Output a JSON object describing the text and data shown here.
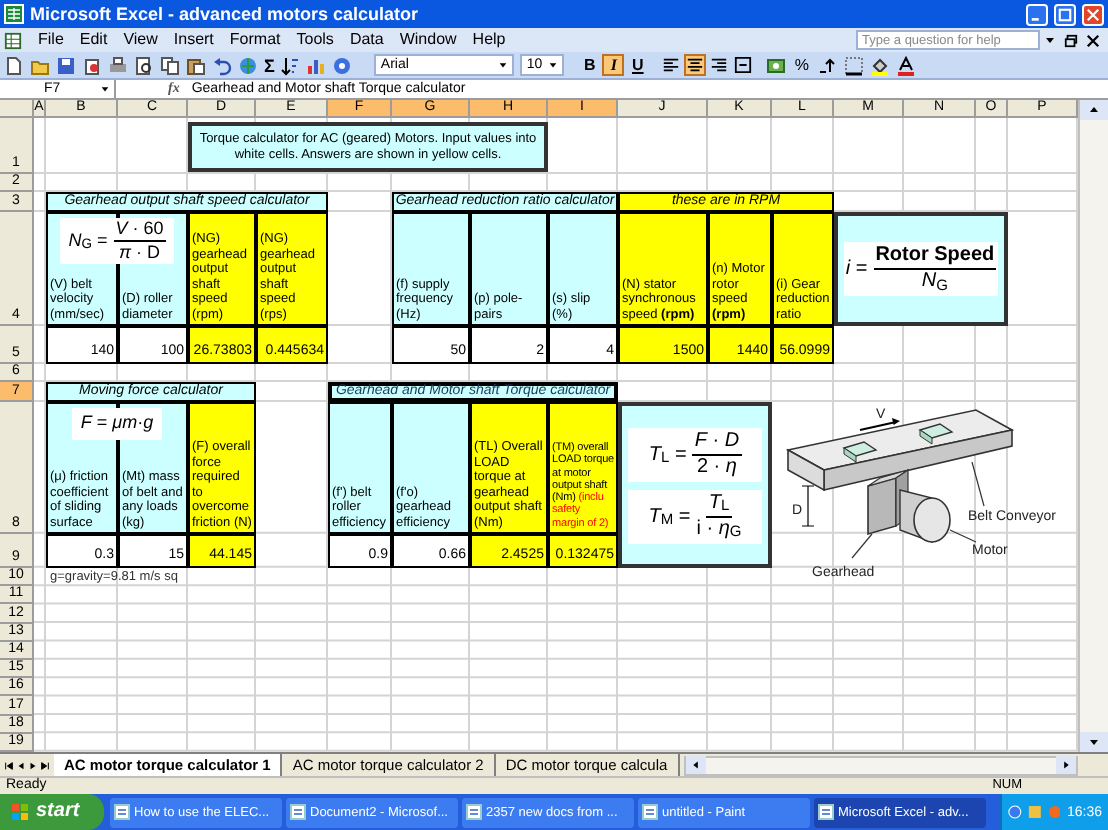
{
  "window": {
    "title": "Microsoft Excel - advanced motors calculator"
  },
  "menu": [
    "File",
    "Edit",
    "View",
    "Insert",
    "Format",
    "Tools",
    "Data",
    "Window",
    "Help"
  ],
  "help_box": {
    "placeholder": "Type a question for help"
  },
  "toolbar": {
    "sum": "Σ",
    "font": "Arial",
    "size": "10",
    "percent": "%",
    "format_buttons": [
      {
        "label": "B",
        "on": false
      },
      {
        "label": "I",
        "on": true
      },
      {
        "label": "U",
        "on": false
      }
    ],
    "align_buttons": [
      {
        "on": false
      },
      {
        "on": true
      },
      {
        "on": false
      },
      {
        "on": false
      }
    ]
  },
  "formula_bar": {
    "name_box": "F7",
    "fx": "fx",
    "content": "Gearhead and Motor shaft Torque calculator"
  },
  "columns": [
    {
      "label": "A",
      "selected": false
    },
    {
      "label": "B",
      "selected": false
    },
    {
      "label": "C",
      "selected": false
    },
    {
      "label": "D",
      "selected": false
    },
    {
      "label": "E",
      "selected": false
    },
    {
      "label": "F",
      "selected": true
    },
    {
      "label": "G",
      "selected": true
    },
    {
      "label": "H",
      "selected": true
    },
    {
      "label": "I",
      "selected": true
    },
    {
      "label": "J",
      "selected": false
    },
    {
      "label": "K",
      "selected": false
    },
    {
      "label": "L",
      "selected": false
    },
    {
      "label": "M",
      "selected": false
    },
    {
      "label": "N",
      "selected": false
    },
    {
      "label": "O",
      "selected": false
    },
    {
      "label": "P",
      "selected": false
    }
  ],
  "rows": [
    {
      "label": "1",
      "selected": false
    },
    {
      "label": "2",
      "selected": false
    },
    {
      "label": "3",
      "selected": false
    },
    {
      "label": "4",
      "selected": false
    },
    {
      "label": "5",
      "selected": false
    },
    {
      "label": "6",
      "selected": false
    },
    {
      "label": "7",
      "selected": true
    },
    {
      "label": "8",
      "selected": false
    },
    {
      "label": "9",
      "selected": false
    },
    {
      "label": "10",
      "selected": false
    },
    {
      "label": "11",
      "selected": false
    },
    {
      "label": "12",
      "selected": false
    },
    {
      "label": "13",
      "selected": false
    },
    {
      "label": "14",
      "selected": false
    },
    {
      "label": "15",
      "selected": false
    },
    {
      "label": "16",
      "selected": false
    },
    {
      "label": "17",
      "selected": false
    },
    {
      "label": "18",
      "selected": false
    },
    {
      "label": "19",
      "selected": false
    }
  ],
  "sheet": {
    "intro": "Torque calculator for AC (geared) Motors. Input values into white cells. Answers are shown in yellow cells.",
    "sections": [
      {
        "title": {
          "text": "Gearhead output shaft speed calculator",
          "kind": "input",
          "selected": false
        },
        "formula": {
          "kind": "fraction",
          "lhs": "*N*$_{G}$ =",
          "numerator": "*V* · 60",
          "denominator": "*π* · D"
        },
        "columns": [
          {
            "header": "(V) belt velocity (mm/sec)",
            "value": "140",
            "kind": "input"
          },
          {
            "header": "(D) roller diameter",
            "value": "100",
            "kind": "input"
          },
          {
            "header": "(NG) gearhead output shaft speed (rpm)",
            "value": "26.73803",
            "kind": "output"
          },
          {
            "header": "(NG) gearhead output shaft speed (rps)",
            "value": "0.445634",
            "kind": "output"
          }
        ]
      },
      {
        "title": {
          "text": "Gearhead reduction ratio calculator",
          "kind": "input",
          "selected": false
        },
        "columns": [
          {
            "header": "(f) supply frequency (Hz)",
            "value": "50",
            "kind": "input"
          },
          {
            "header": "(p) pole-pairs",
            "value": "2",
            "kind": "input"
          },
          {
            "header": "(s) slip (%)",
            "value": "4",
            "kind": "input"
          }
        ]
      },
      {
        "title": {
          "text": "these are in RPM",
          "kind": "output",
          "selected": false
        },
        "columns": [
          {
            "header": "(N) stator synchronous speed **(rpm)**",
            "value": "1500",
            "kind": "output"
          },
          {
            "header": "(n) Motor rotor speed **(rpm)**",
            "value": "1440",
            "kind": "output"
          },
          {
            "header": "(i) Gear reduction ratio",
            "value": "56.0999",
            "kind": "output"
          }
        ]
      },
      {
        "title": {
          "text": "Moving force calculator",
          "kind": "input",
          "selected": false
        },
        "formula": {
          "kind": "inline",
          "text": "*F* = *μm*·*g*"
        },
        "columns": [
          {
            "header": "(μ) friction coefficient of sliding surface",
            "value": "0.3",
            "kind": "input"
          },
          {
            "header": "(Mt) mass of belt and any loads (kg)",
            "value": "15",
            "kind": "input"
          },
          {
            "header": "(F) overall force required to overcome friction (N)",
            "value": "44.145",
            "kind": "output"
          }
        ]
      },
      {
        "title": {
          "text": "Gearhead and Motor shaft Torque calculator",
          "kind": "input",
          "selected": true
        },
        "columns": [
          {
            "header": "(f') belt roller efficiency",
            "value": "0.9",
            "kind": "input"
          },
          {
            "header": "(f'o) gearhead efficiency",
            "value": "0.66",
            "kind": "input"
          },
          {
            "header": "(TL) Overall LOAD torque at gearhead output shaft (Nm)",
            "value": "2.4525",
            "kind": "output"
          },
          {
            "header": "(TM) overall LOAD torque at motor output shaft (Nm)",
            "note": "(inclu safety margin of 2)",
            "value": "0.132475",
            "kind": "output"
          }
        ]
      }
    ],
    "formula_panels": [
      {
        "formulas": [
          {
            "kind": "fraction",
            "lhs": "*i* =",
            "numerator": "**Rotor Speed**",
            "denominator": "*N*$_{G}$"
          }
        ]
      },
      {
        "formulas": [
          {
            "kind": "fraction",
            "lhs": "*T*$_{L}$ =",
            "numerator": "*F* · *D*",
            "denominator": "2 · *η*"
          },
          {
            "kind": "fraction",
            "lhs": "*T*$_{M}$ =",
            "numerator": "*T*$_{L}$",
            "denominator": "i · *η*$_{G}$"
          }
        ]
      }
    ],
    "note": "g=gravity=9.81 m/s sq",
    "drawing": {
      "labels": [
        "V",
        "D",
        "Belt Conveyor",
        "Motor",
        "Gearhead"
      ]
    }
  },
  "sheet_tabs": [
    {
      "label": "AC motor torque calculator 1",
      "selected": true
    },
    {
      "label": "AC motor torque calculator 2",
      "selected": false
    },
    {
      "label": "DC motor torque calcula",
      "selected": false
    }
  ],
  "status_bar": {
    "text": "Ready",
    "num": "NUM"
  },
  "taskbar": {
    "start": "start",
    "tasks": [
      {
        "label": "How to use the ELEC...",
        "selected": false
      },
      {
        "label": "Document2 - Microsof...",
        "selected": false
      },
      {
        "label": "2357 new docs from ...",
        "selected": false
      },
      {
        "label": "untitled - Paint",
        "selected": false
      },
      {
        "label": "Microsoft Excel - adv...",
        "selected": true
      }
    ],
    "clock": "16:36"
  }
}
